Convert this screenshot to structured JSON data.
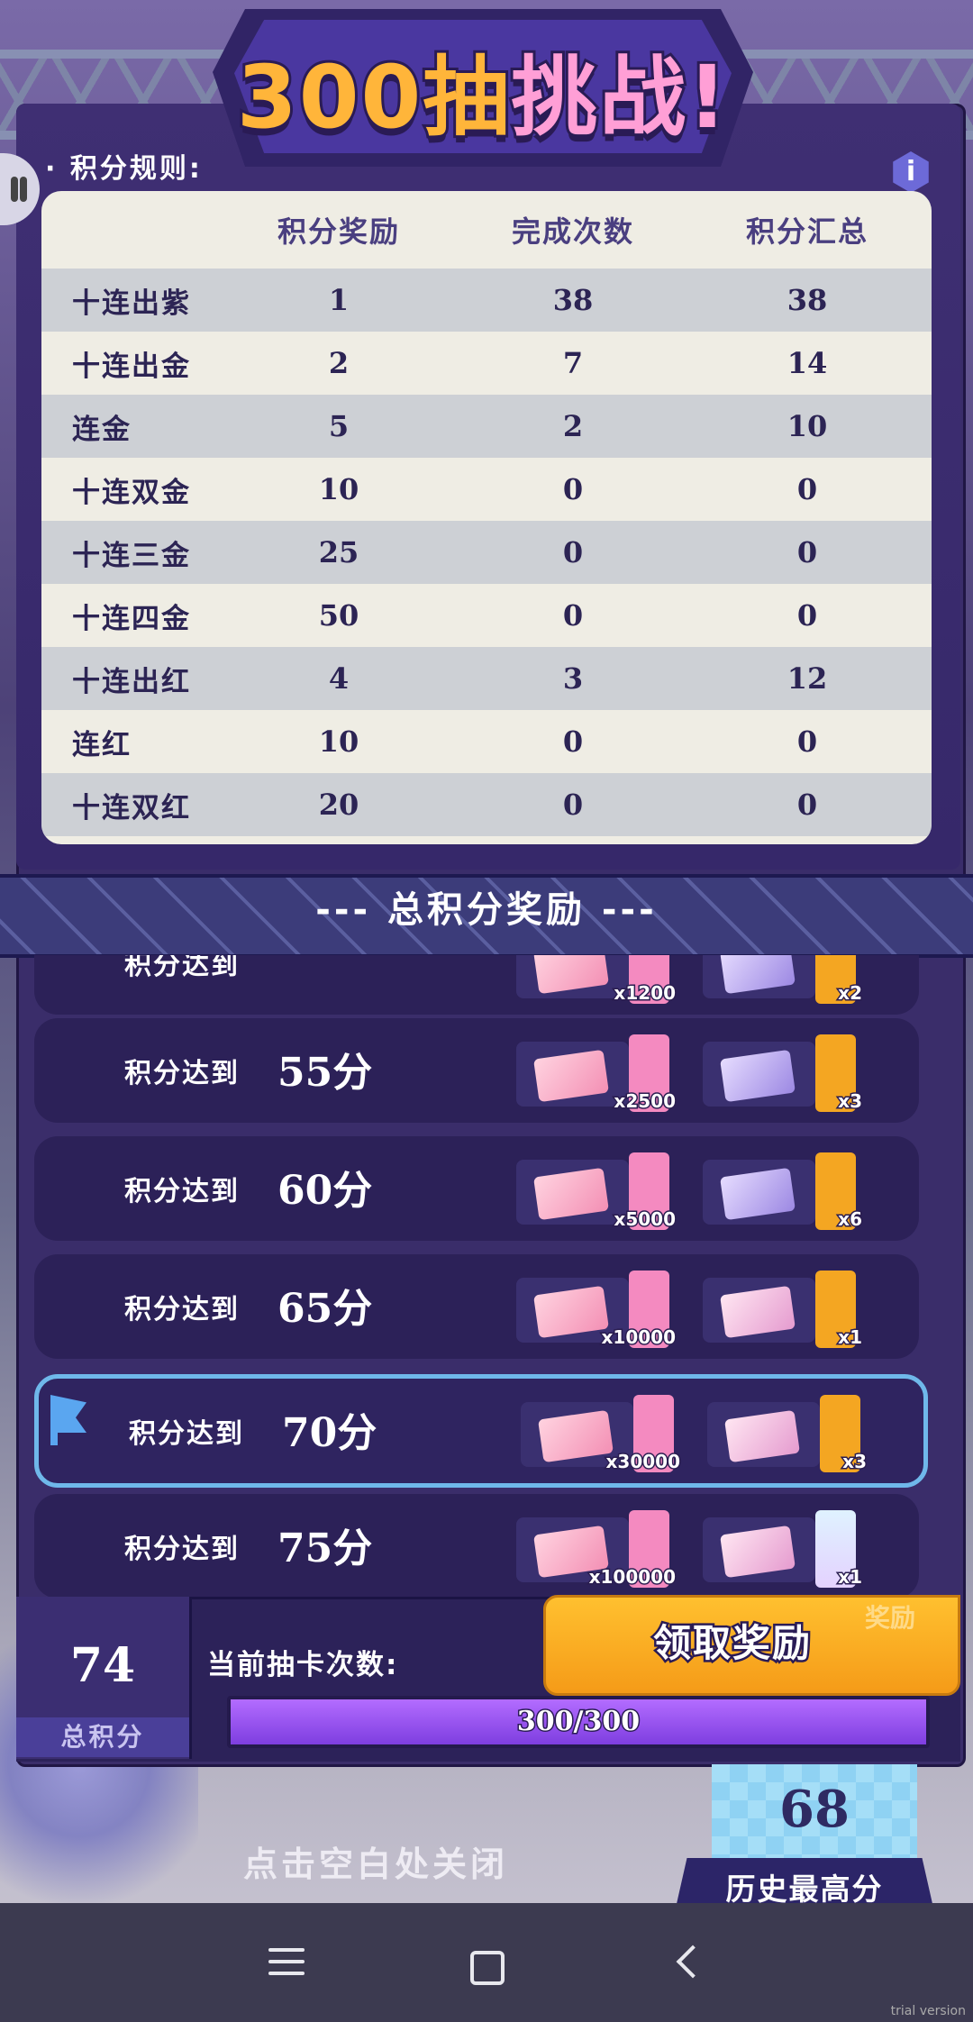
{
  "title": {
    "main": "300抽",
    "accent": "挑战!"
  },
  "rules_label": "· 积分规则:",
  "table": {
    "headers": [
      "",
      "积分奖励",
      "完成次数",
      "积分汇总"
    ],
    "rows": [
      [
        "十连出紫",
        "1",
        "38",
        "38"
      ],
      [
        "十连出金",
        "2",
        "7",
        "14"
      ],
      [
        "连金",
        "5",
        "2",
        "10"
      ],
      [
        "十连双金",
        "10",
        "0",
        "0"
      ],
      [
        "十连三金",
        "25",
        "0",
        "0"
      ],
      [
        "十连四金",
        "50",
        "0",
        "0"
      ],
      [
        "十连出红",
        "4",
        "3",
        "12"
      ],
      [
        "连红",
        "10",
        "0",
        "0"
      ],
      [
        "十连双红",
        "20",
        "0",
        "0"
      ]
    ]
  },
  "section_title": "--- 总积分奖励 ---",
  "rewards": [
    {
      "label": "积分达到",
      "score": "",
      "r1_count": "x1200",
      "r2_count": "x2",
      "r2_style": "purple",
      "r2_stub": "gold",
      "partial": true
    },
    {
      "label": "积分达到",
      "score": "55分",
      "r1_count": "x2500",
      "r2_count": "x3",
      "r2_style": "purple",
      "r2_stub": "gold"
    },
    {
      "label": "积分达到",
      "score": "60分",
      "r1_count": "x5000",
      "r2_count": "x6",
      "r2_style": "purple",
      "r2_stub": "gold"
    },
    {
      "label": "积分达到",
      "score": "65分",
      "r1_count": "x10000",
      "r2_count": "x1",
      "r2_style": "pink2",
      "r2_stub": "gold"
    },
    {
      "label": "积分达到",
      "score": "70分",
      "r1_count": "x30000",
      "r2_count": "x3",
      "r2_style": "pink2",
      "r2_stub": "gold",
      "active": true
    },
    {
      "label": "积分达到",
      "score": "75分",
      "r1_count": "x100000",
      "r2_count": "x1",
      "r2_style": "pink2",
      "r2_stub": "silver"
    }
  ],
  "bottom": {
    "total_value": "74",
    "total_label": "总积分",
    "draw_label": "当前抽卡次数:",
    "progress_text": "300/300",
    "progress_fraction": 1.0,
    "claim_button": "领取奖励",
    "claim_tag": "奖励"
  },
  "history": {
    "value": "68",
    "label": "历史最高分"
  },
  "close_hint": "点击空白处关闭",
  "watermark": "trial version",
  "colors": {
    "accent_gold": "#f59b18",
    "panel": "#3a2d6a",
    "progress": "#9a55f0"
  }
}
